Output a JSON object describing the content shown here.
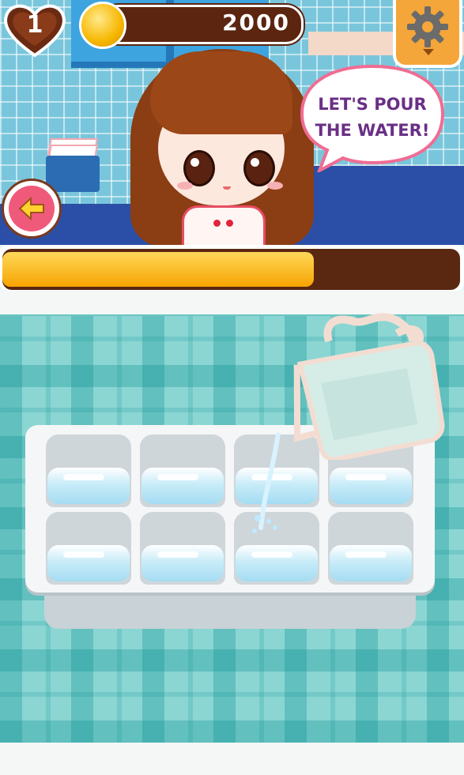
{
  "hud": {
    "lives": "1",
    "coins": "2000",
    "settings_icon": "gear-icon",
    "back_icon": "arrow-left-icon"
  },
  "dialog": {
    "line1": "LET'S POUR",
    "line2": "THE WATER!"
  },
  "progress": {
    "fraction": 0.68
  },
  "colors": {
    "coin_bar": "#5b2510",
    "progress_fill": "#f7b400",
    "settings_button": "#f4a63a",
    "back_button": "#f05a7a",
    "speech_text": "#6a2f86"
  },
  "ice_tray": {
    "rows": 2,
    "cols": 4,
    "filled_cells": 8
  }
}
